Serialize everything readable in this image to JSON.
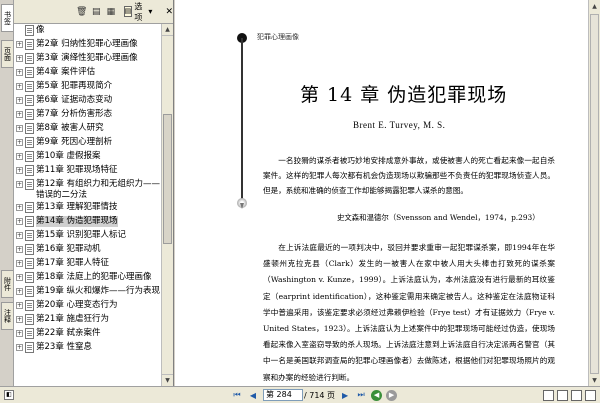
{
  "side_tabs": {
    "bookmarks": "书签",
    "pages": "页面",
    "attachments": "附件",
    "comments": "注释"
  },
  "panel": {
    "options_label": "选项",
    "items": [
      {
        "label": "像",
        "expandable": false,
        "wrap": false
      },
      {
        "label": "第2章  归纳性犯罪心理画像",
        "expandable": true
      },
      {
        "label": "第3章  演绎性犯罪心理画像",
        "expandable": true
      },
      {
        "label": "第4章  案件评估",
        "expandable": true
      },
      {
        "label": "第5章  犯罪再现简介",
        "expandable": true
      },
      {
        "label": "第6章  证据动态变动",
        "expandable": true
      },
      {
        "label": "第7章  分析伤害形态",
        "expandable": true
      },
      {
        "label": "第8章  被害人研究",
        "expandable": true
      },
      {
        "label": "第9章  死因心理剖析",
        "expandable": true
      },
      {
        "label": "第10章  虚假报案",
        "expandable": true
      },
      {
        "label": "第11章  犯罪现场特征",
        "expandable": true
      },
      {
        "label": "第12章  有组织力和无组织力——错误的二分法",
        "expandable": true
      },
      {
        "label": "第13章  理解犯罪情技",
        "expandable": true
      },
      {
        "label": "第14章  伪造犯罪现场",
        "expandable": true,
        "selected": true
      },
      {
        "label": "第15章  识别犯罪人标记",
        "expandable": true
      },
      {
        "label": "第16章  犯罪动机",
        "expandable": true
      },
      {
        "label": "第17章  犯罪人特征",
        "expandable": true
      },
      {
        "label": "第18章  法庭上的犯罪心理画像",
        "expandable": true
      },
      {
        "label": "第19章  纵火和爆炸——行为表现",
        "expandable": true
      },
      {
        "label": "第20章  心理变态行为",
        "expandable": true
      },
      {
        "label": "第21章  施虐狂行为",
        "expandable": true
      },
      {
        "label": "第22章  弑亲案件",
        "expandable": true
      },
      {
        "label": "第23章  性窒息",
        "expandable": true
      }
    ]
  },
  "document": {
    "running_head": "犯罪心理画像",
    "chapter_title": "第 14 章    伪造犯罪现场",
    "author": "Brent E. Turvey, M. S.",
    "epigraph": "一名狡猾的谋杀者被巧妙地安排成意外事故，或使被害人的死亡看起来像一起自杀案件。这样的犯罪人每次都有机会伪造现场以欺骗那些不负责任的犯罪现场侦查人员。但是，系统和准确的侦查工作却能够揭露犯罪人谋杀的意图。",
    "source": "史文森和温德尔（Svensson and Wendel，1974，p.293）",
    "body": "在上诉法庭最近的一项判决中，驳回并要求重审一起犯罪谋杀案，即1994年在华盛顿州克拉克县（Clark）发生的一被害人在家中被人用大头棒击打致死的谋杀案（Washington v. Kunze，1999）。上诉法庭认为，本州法庭没有进行最新的耳纹鉴定（earprint identification），这种鉴定需用来确定被告人。这种鉴定在法庭物证科学中普遍采用，该鉴定要求必须经过弗赖伊检验（Frye test）才有证据效力（Frye v. United States，1923）。上诉法庭认为上述案件中的犯罪现场可能经过伪造，使现场看起来像入室盗窃导致的杀人现场。上诉法庭注意到上诉法庭自行决定派两名警官（其中一名是美国联邦调查局的犯罪心理画像者）去做陈述，根据他们对犯罪现场照片的观察和办案的经验进行判断。"
  },
  "statusbar": {
    "page_current": "第 284",
    "page_total": "/ 714 页"
  }
}
